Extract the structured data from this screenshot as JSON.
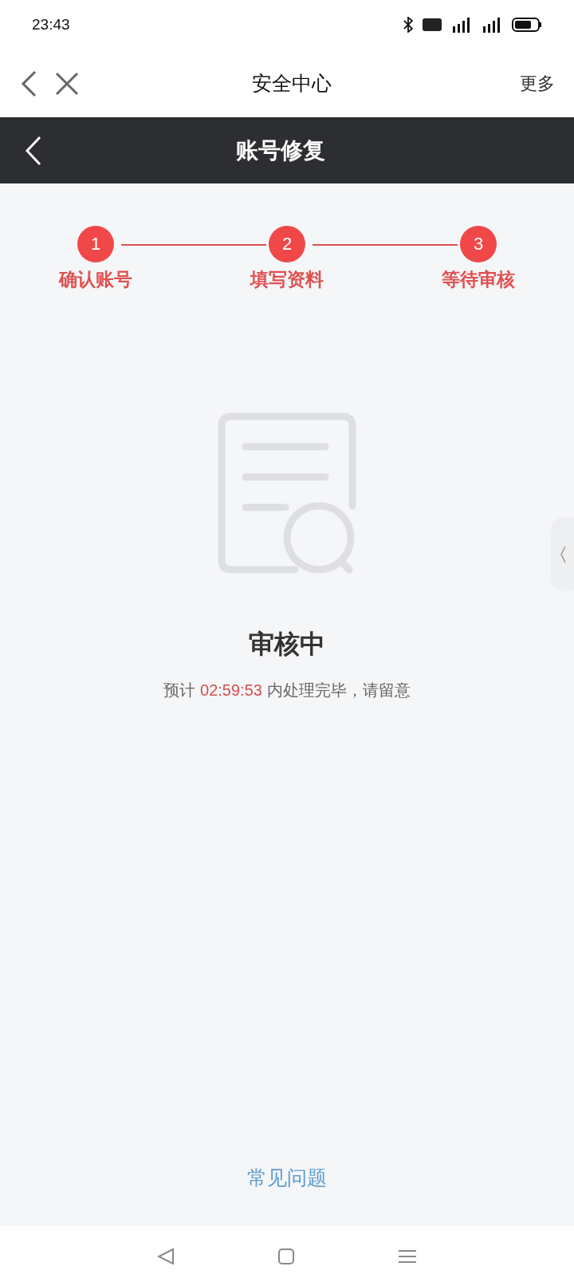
{
  "status_bar": {
    "time": "23:43"
  },
  "top_nav": {
    "title": "安全中心",
    "more": "更多"
  },
  "header": {
    "title": "账号修复"
  },
  "steps": [
    {
      "number": "1",
      "label": "确认账号"
    },
    {
      "number": "2",
      "label": "填写资料"
    },
    {
      "number": "3",
      "label": "等待审核"
    }
  ],
  "status": {
    "title": "审核中",
    "note_before": "预计",
    "countdown": "02:59:53",
    "note_after": "内处理完毕，请留意"
  },
  "faq_link": "常见问题"
}
